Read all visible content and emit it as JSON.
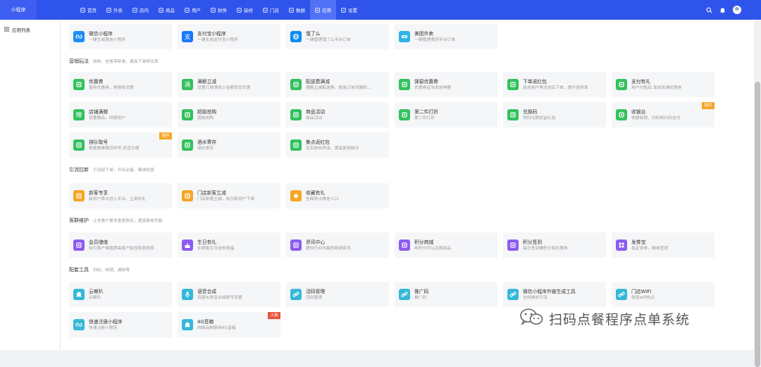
{
  "app": {
    "logo": "小程序"
  },
  "nav": [
    {
      "label": "首页",
      "icon": "home-icon"
    },
    {
      "label": "外卖",
      "icon": "delivery-icon"
    },
    {
      "label": "店内",
      "icon": "store-icon"
    },
    {
      "label": "商品",
      "icon": "goods-icon"
    },
    {
      "label": "用户",
      "icon": "user-icon"
    },
    {
      "label": "财务",
      "icon": "finance-icon"
    },
    {
      "label": "装修",
      "icon": "decorate-icon"
    },
    {
      "label": "门店",
      "icon": "shop-icon"
    },
    {
      "label": "数据",
      "icon": "chart-icon"
    },
    {
      "label": "应用",
      "icon": "apps-icon",
      "active": true
    },
    {
      "label": "设置",
      "icon": "settings-icon"
    }
  ],
  "sidebar": {
    "items": [
      {
        "label": "应用列表",
        "icon": "apps-icon"
      }
    ]
  },
  "sections": [
    {
      "title": "",
      "desc": ""
    },
    {
      "title": "营销玩法",
      "desc": "吸粉、老客带新客，提高下单转化率"
    },
    {
      "title": "引流拉新",
      "desc": "引流促下单，开店必备，精准揽客"
    },
    {
      "title": "客群维护",
      "desc": "让老客户更多重复购买，提高客单贡献"
    },
    {
      "title": "配套工具",
      "desc": "扫码、核销、调研等"
    }
  ],
  "cards": [
    [
      {
        "name": "微信小程序",
        "desc": "一键生成微信小程序",
        "color": "#1d8cf8",
        "icon": "mini-program-icon"
      },
      {
        "name": "支付宝小程序",
        "desc": "一键生成支付宝小程序",
        "color": "#1677ff",
        "icon": "alipay-icon"
      },
      {
        "name": "饿了么",
        "desc": "一键管理饿了么平台订单",
        "color": "#0a8cf0",
        "icon": "eleme-icon"
      },
      {
        "name": "美团外卖",
        "desc": "一键管理美团平台订单",
        "color": "#2fb3e6",
        "icon": "meituan-icon"
      }
    ],
    [
      {
        "name": "优惠券",
        "desc": "使用优惠券，购物有优惠",
        "color": "#33c15d",
        "icon": "coupon-icon"
      },
      {
        "name": "满额立减",
        "desc": "设置订单满多少金额享受优惠",
        "color": "#33c15d",
        "icon": "full-reduce-icon"
      },
      {
        "name": "配送费满减",
        "desc": "满额立减配送费，提高订单流量和...",
        "color": "#33c15d",
        "icon": "delivery-fee-icon"
      },
      {
        "name": "弹窗优惠券",
        "desc": "优惠券定向发放神器",
        "color": "#33c15d",
        "icon": "popup-coupon-icon"
      },
      {
        "name": "下单返红包",
        "desc": "促进用户再次进店下单，提升复购率",
        "color": "#33c15d",
        "icon": "order-redpack-icon"
      },
      {
        "name": "支付有礼",
        "desc": "用户付款后 发放店铺优惠券",
        "color": "#33c15d",
        "icon": "pay-gift-icon"
      },
      {
        "name": "店铺满赠",
        "desc": "设置赠品，回馈用户",
        "color": "#33c15d",
        "icon": "gift-icon"
      },
      {
        "name": "超级抢购",
        "desc": "超级抢购",
        "color": "#33c15d",
        "icon": "flash-sale-icon"
      },
      {
        "name": "商品活动",
        "desc": "商品活动",
        "color": "#33c15d",
        "icon": "goods-activity-icon"
      },
      {
        "name": "第二件打折",
        "desc": "第二件打折",
        "color": "#33c15d",
        "icon": "discount-tag-icon"
      },
      {
        "name": "兑换码",
        "desc": "凭码兑换权益礼包",
        "color": "#33c15d",
        "icon": "redeem-code-icon"
      },
      {
        "name": "收银台",
        "desc": "快捷收银、扫码枪扫码支付",
        "color": "#33c15d",
        "icon": "cashier-icon",
        "badge": "插件",
        "badgeColor": "orange"
      },
      {
        "name": "排队取号",
        "desc": "根据餐桌情况叫号,灵活方便",
        "color": "#33c15d",
        "icon": "queue-icon",
        "badge": "插件",
        "badgeColor": "orange"
      },
      {
        "name": "酒水寄存",
        "desc": "酒水寄存",
        "color": "#33c15d",
        "icon": "storage-icon"
      },
      {
        "name": "集点返红包",
        "desc": "忠实粉丝养成，提高复购频次",
        "color": "#33c15d",
        "icon": "points-redpack-icon"
      }
    ],
    [
      {
        "name": "新客专享",
        "desc": "新用户首次进入平台，立享好礼",
        "color": "#f5a623",
        "icon": "new-customer-icon"
      },
      {
        "name": "门店新客立减",
        "desc": "门店新客立减，吸引新用户下单",
        "color": "#f5a623",
        "icon": "new-reduce-icon"
      },
      {
        "name": "收藏有礼",
        "desc": "全面抢占微信入口",
        "color": "#f5a623",
        "icon": "star-icon"
      }
    ],
    [
      {
        "name": "会员储值",
        "desc": "吸引客户储值提高客户粘性和复购率",
        "color": "#8c5cf0",
        "icon": "recharge-icon"
      },
      {
        "name": "生日有礼",
        "desc": "在顾客生日送去祝福",
        "color": "#8c5cf0",
        "icon": "birthday-icon"
      },
      {
        "name": "资讯中心",
        "desc": "提供行业的最热新闻资讯",
        "color": "#8c5cf0",
        "icon": "news-icon"
      },
      {
        "name": "积分商城",
        "desc": "用积分可以兑换商品",
        "color": "#8c5cf0",
        "icon": "points-mall-icon"
      },
      {
        "name": "积分签到",
        "desc": "每日签到赚积分和优惠券",
        "color": "#8c5cf0",
        "icon": "checkin-icon"
      },
      {
        "name": "发券宝",
        "desc": "指定发券，精准营销",
        "color": "#8c5cf0",
        "icon": "coupon-send-icon"
      }
    ],
    [
      {
        "name": "云喇叭",
        "desc": "云喇叭",
        "color": "#35b8d8",
        "icon": "cloud-speaker-icon"
      },
      {
        "name": "语音合成",
        "desc": "百度AI语音合成账号设置",
        "color": "#35b8d8",
        "icon": "microphone-icon"
      },
      {
        "name": "活码管理",
        "desc": "活码管理",
        "color": "#35b8d8",
        "icon": "link-icon"
      },
      {
        "name": "推广码",
        "desc": "推广码",
        "color": "#35b8d8",
        "icon": "link-icon"
      },
      {
        "name": "微信小程序外链生成工具",
        "desc": "全网推效引流",
        "color": "#35b8d8",
        "icon": "link-icon"
      },
      {
        "name": "门店WIFI",
        "desc": "免密wifi热点",
        "color": "#35b8d8",
        "icon": "link-icon"
      },
      {
        "name": "快速注册小程序",
        "desc": "快速注册小程序",
        "color": "#35b8d8",
        "icon": "mini-program-icon"
      },
      {
        "name": "4G音箱",
        "desc": "网维云物联网4G音箱",
        "color": "#35b8d8",
        "icon": "speaker-icon",
        "badge": "上新",
        "badgeColor": "red"
      }
    ]
  ],
  "watermark": {
    "text": "扫码点餐程序点单系统",
    "icon": "wechat-icon"
  }
}
